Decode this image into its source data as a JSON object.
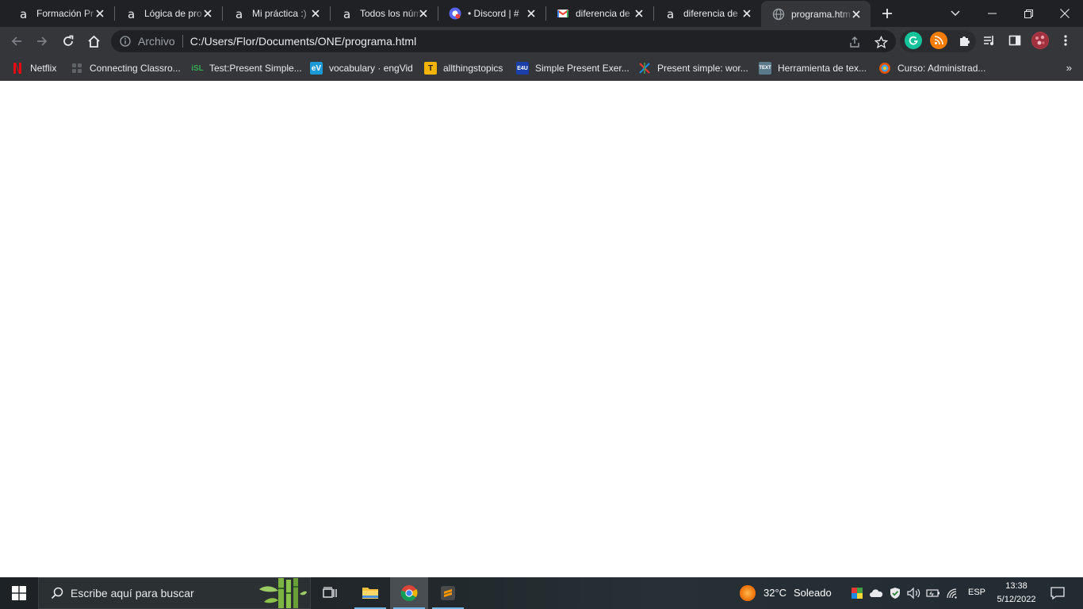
{
  "browser": {
    "tabs": [
      {
        "title": "Formación Pr",
        "favicon": "alura-icon",
        "active": false
      },
      {
        "title": "Lógica de pro",
        "favicon": "alura-icon",
        "active": false
      },
      {
        "title": "Mi práctica :)",
        "favicon": "alura-icon",
        "active": false
      },
      {
        "title": "Todos los núm",
        "favicon": "alura-icon",
        "active": false
      },
      {
        "title": "• Discord | #",
        "favicon": "discord-icon",
        "active": false
      },
      {
        "title": "diferencia de",
        "favicon": "gmail-icon",
        "active": false
      },
      {
        "title": "diferencia de",
        "favicon": "alura-icon",
        "active": false
      },
      {
        "title": "programa.htm",
        "favicon": "globe-icon",
        "active": true
      }
    ],
    "omnibox": {
      "scheme_label": "Archivo",
      "url": "C:/Users/Flor/Documents/ONE/programa.html"
    },
    "bookmarks": [
      {
        "label": "Netflix",
        "icon": "netflix-icon",
        "color": "#e50914"
      },
      {
        "label": "Connecting Classro...",
        "icon": "apps-icon",
        "color": "#5f6368"
      },
      {
        "label": "Test:Present Simple...",
        "icon": "isl-icon",
        "badge": "iSL",
        "color": "#34a853"
      },
      {
        "label": "vocabulary · engVid",
        "icon": "engvid-icon",
        "badge": "eV",
        "color": "#1a9ad6"
      },
      {
        "label": "allthingstopics",
        "icon": "allthingstopics-icon",
        "badge": "T",
        "color": "#f4b400"
      },
      {
        "label": "Simple Present Exer...",
        "icon": "e4u-icon",
        "badge": "E4U",
        "color": "#1a3fa8"
      },
      {
        "label": "Present simple: wor...",
        "icon": "cross-icon",
        "color": "#9c27b0"
      },
      {
        "label": "Herramienta de tex...",
        "icon": "text-tool-icon",
        "badge": "TEXT",
        "color": "#5a7a8c"
      },
      {
        "label": "Curso: Administrad...",
        "icon": "course-icon",
        "color": "#e65100"
      }
    ],
    "more_bookmarks": "»"
  },
  "taskbar": {
    "search_placeholder": "Escribe aquí para buscar",
    "weather_temp": "32°C",
    "weather_desc": "Soleado",
    "language": "ESP",
    "time": "13:38",
    "date": "5/12/2022"
  },
  "colors": {
    "tab_strip": "#202124",
    "toolbar": "#35363a",
    "omnibox": "#202124",
    "text": "#e8eaed",
    "accent": "#76b9ed"
  }
}
